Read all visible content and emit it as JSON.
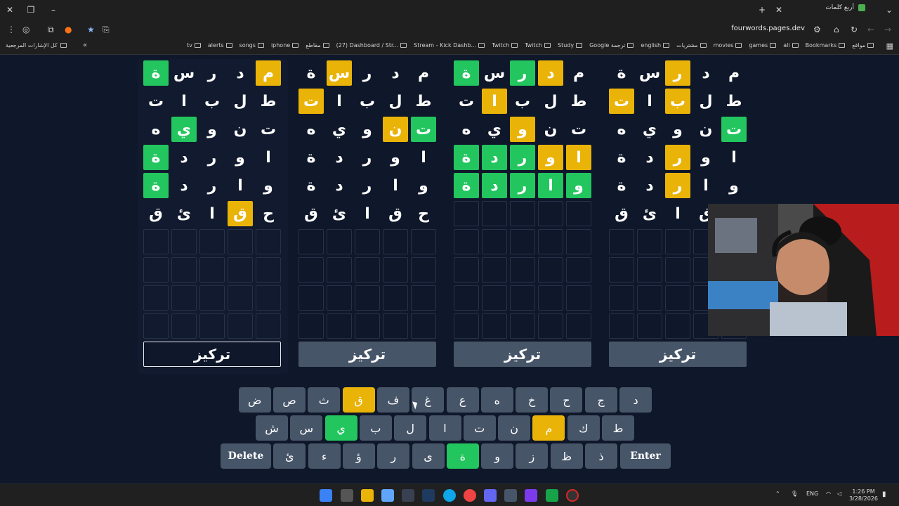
{
  "browser": {
    "tab_title": "أربع كلمات",
    "url": "fourwords.pages.dev",
    "bookmarks": [
      "Bookmarks",
      "ali",
      "games",
      "movies",
      "مشتريات",
      "english",
      "Google ترجمة",
      "Study",
      "Twitch",
      "Twitch",
      "Stream - Kick Dashb...",
      "(27) Dashboard / Str...",
      "مقاطع",
      "iphone",
      "songs",
      "alerts",
      "tv"
    ],
    "bookmark_first": "مواقع",
    "all_bookmarks": "كل الإشارات المرجعية"
  },
  "boards": [
    {
      "rows": [
        [
          [
            "م",
            "yellow"
          ],
          [
            "د",
            ""
          ],
          [
            "ر",
            ""
          ],
          [
            "س",
            ""
          ],
          [
            "ة",
            "green"
          ]
        ],
        [
          [
            "ط",
            ""
          ],
          [
            "ل",
            ""
          ],
          [
            "ب",
            ""
          ],
          [
            "ا",
            ""
          ],
          [
            "ت",
            ""
          ]
        ],
        [
          [
            "ت",
            ""
          ],
          [
            "ن",
            ""
          ],
          [
            "و",
            ""
          ],
          [
            "ي",
            "green"
          ],
          [
            "ه",
            ""
          ]
        ],
        [
          [
            "ا",
            ""
          ],
          [
            "و",
            ""
          ],
          [
            "ر",
            ""
          ],
          [
            "د",
            ""
          ],
          [
            "ة",
            "green"
          ]
        ],
        [
          [
            "و",
            ""
          ],
          [
            "ا",
            ""
          ],
          [
            "ر",
            ""
          ],
          [
            "د",
            ""
          ],
          [
            "ة",
            "green"
          ]
        ],
        [
          [
            "ح",
            ""
          ],
          [
            "ق",
            "yellow"
          ],
          [
            "ا",
            ""
          ],
          [
            "ئ",
            ""
          ],
          [
            "ق",
            ""
          ]
        ]
      ],
      "focus": "تركيز",
      "active": true
    },
    {
      "rows": [
        [
          [
            "م",
            ""
          ],
          [
            "د",
            ""
          ],
          [
            "ر",
            ""
          ],
          [
            "س",
            "yellow"
          ],
          [
            "ة",
            ""
          ]
        ],
        [
          [
            "ط",
            ""
          ],
          [
            "ل",
            ""
          ],
          [
            "ب",
            ""
          ],
          [
            "ا",
            ""
          ],
          [
            "ت",
            "yellow"
          ]
        ],
        [
          [
            "ت",
            "green"
          ],
          [
            "ن",
            "yellow"
          ],
          [
            "و",
            ""
          ],
          [
            "ي",
            ""
          ],
          [
            "ه",
            ""
          ]
        ],
        [
          [
            "ا",
            ""
          ],
          [
            "و",
            ""
          ],
          [
            "ر",
            ""
          ],
          [
            "د",
            ""
          ],
          [
            "ة",
            ""
          ]
        ],
        [
          [
            "و",
            ""
          ],
          [
            "ا",
            ""
          ],
          [
            "ر",
            ""
          ],
          [
            "د",
            ""
          ],
          [
            "ة",
            ""
          ]
        ],
        [
          [
            "ح",
            ""
          ],
          [
            "ق",
            ""
          ],
          [
            "ا",
            ""
          ],
          [
            "ئ",
            ""
          ],
          [
            "ق",
            ""
          ]
        ]
      ],
      "focus": "تركيز",
      "active": false
    },
    {
      "rows": [
        [
          [
            "م",
            ""
          ],
          [
            "د",
            "yellow"
          ],
          [
            "ر",
            "green"
          ],
          [
            "س",
            ""
          ],
          [
            "ة",
            "green"
          ]
        ],
        [
          [
            "ط",
            ""
          ],
          [
            "ل",
            ""
          ],
          [
            "ب",
            ""
          ],
          [
            "ا",
            "yellow"
          ],
          [
            "ت",
            ""
          ]
        ],
        [
          [
            "ت",
            ""
          ],
          [
            "ن",
            ""
          ],
          [
            "و",
            "yellow"
          ],
          [
            "ي",
            ""
          ],
          [
            "ه",
            ""
          ]
        ],
        [
          [
            "ا",
            "yellow"
          ],
          [
            "و",
            "yellow"
          ],
          [
            "ر",
            "green"
          ],
          [
            "د",
            "green"
          ],
          [
            "ة",
            "green"
          ]
        ],
        [
          [
            "و",
            "green"
          ],
          [
            "ا",
            "green"
          ],
          [
            "ر",
            "green"
          ],
          [
            "د",
            "green"
          ],
          [
            "ة",
            "green"
          ]
        ]
      ],
      "focus": "تركيز",
      "active": false
    },
    {
      "rows": [
        [
          [
            "م",
            ""
          ],
          [
            "د",
            ""
          ],
          [
            "ر",
            "yellow"
          ],
          [
            "س",
            ""
          ],
          [
            "ة",
            ""
          ]
        ],
        [
          [
            "ط",
            ""
          ],
          [
            "ل",
            ""
          ],
          [
            "ب",
            "yellow"
          ],
          [
            "ا",
            ""
          ],
          [
            "ت",
            "yellow"
          ]
        ],
        [
          [
            "ت",
            "green"
          ],
          [
            "ن",
            ""
          ],
          [
            "و",
            ""
          ],
          [
            "ي",
            ""
          ],
          [
            "ه",
            ""
          ]
        ],
        [
          [
            "ا",
            ""
          ],
          [
            "و",
            ""
          ],
          [
            "ر",
            "yellow"
          ],
          [
            "د",
            ""
          ],
          [
            "ة",
            ""
          ]
        ],
        [
          [
            "و",
            ""
          ],
          [
            "ا",
            ""
          ],
          [
            "ر",
            "yellow"
          ],
          [
            "د",
            ""
          ],
          [
            "ة",
            ""
          ]
        ],
        [
          [
            "ح",
            ""
          ],
          [
            "ق",
            ""
          ],
          [
            "ا",
            ""
          ],
          [
            "ئ",
            ""
          ],
          [
            "ق",
            ""
          ]
        ]
      ],
      "focus": "تركيز",
      "active": false
    }
  ],
  "keyboard": {
    "row1": [
      [
        "د",
        ""
      ],
      [
        "ج",
        ""
      ],
      [
        "ح",
        ""
      ],
      [
        "خ",
        ""
      ],
      [
        "ه",
        ""
      ],
      [
        "ع",
        ""
      ],
      [
        "غ",
        ""
      ],
      [
        "ف",
        ""
      ],
      [
        "ق",
        "yellow"
      ],
      [
        "ث",
        ""
      ],
      [
        "ص",
        ""
      ],
      [
        "ض",
        ""
      ]
    ],
    "row2": [
      [
        "ط",
        ""
      ],
      [
        "ك",
        ""
      ],
      [
        "م",
        "yellow"
      ],
      [
        "ن",
        ""
      ],
      [
        "ت",
        ""
      ],
      [
        "ا",
        ""
      ],
      [
        "ل",
        ""
      ],
      [
        "ب",
        ""
      ],
      [
        "ي",
        "green"
      ],
      [
        "س",
        ""
      ],
      [
        "ش",
        ""
      ]
    ],
    "row3": [
      [
        "ذ",
        ""
      ],
      [
        "ظ",
        ""
      ],
      [
        "ز",
        ""
      ],
      [
        "و",
        ""
      ],
      [
        "ة",
        "green"
      ],
      [
        "ى",
        ""
      ],
      [
        "ر",
        ""
      ],
      [
        "ؤ",
        ""
      ],
      [
        "ء",
        ""
      ],
      [
        "ئ",
        ""
      ]
    ],
    "delete": "Delete",
    "enter": "Enter"
  },
  "colors": {
    "green": "#22c55e",
    "yellow": "#eab308",
    "bg": "#0f172a",
    "key": "#475569"
  },
  "taskbar": {
    "lang": "ENG",
    "time": "1:26 PM",
    "date": "3/28/2026"
  }
}
